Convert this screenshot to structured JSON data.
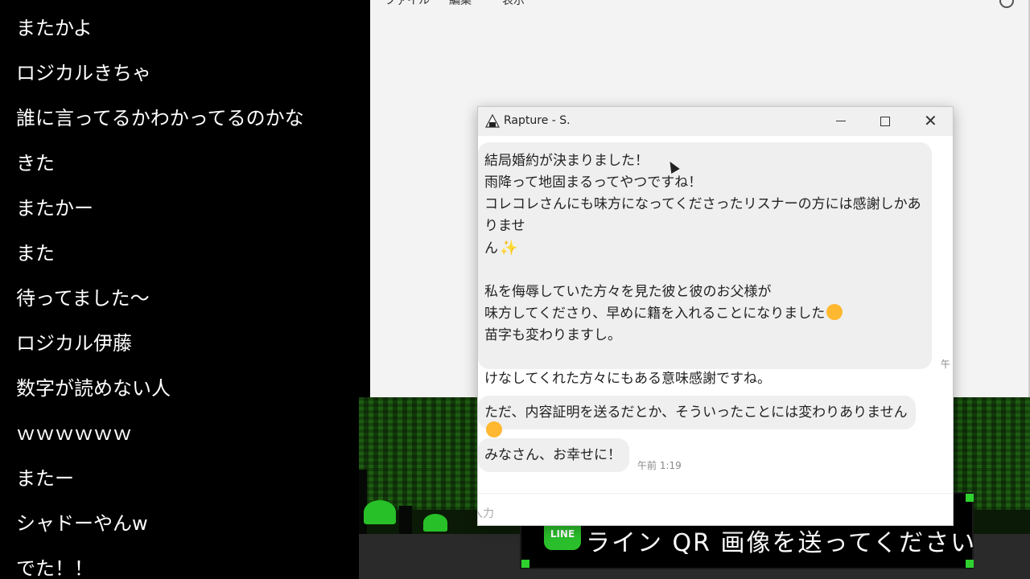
{
  "comments": [
    "またかよ",
    "ロジカルきちゃ",
    "誰に言ってるかわかってるのかな",
    "きた",
    "またかー",
    "また",
    "待ってました〜",
    "ロジカル伊藤",
    "数字が読めない人",
    "ｗｗｗｗｗｗ",
    "またー",
    "シャドーやんw",
    "でた！！"
  ],
  "bg_window": {
    "menu": [
      "ファイル",
      "編集",
      "表示"
    ]
  },
  "chat_window": {
    "title": "Rapture - S.",
    "app_icon": "rice-ball-icon",
    "messages": [
      {
        "lines": [
          "結局婚約が決まりました！",
          "雨降って地固まるってやつですね！",
          "コレコレさんにも味方になってくださったリスナーの方には感謝しかありませ",
          "ん",
          "",
          "私を侮辱していた方々を見た彼と彼のお父様が",
          "味方してくださり、早めに籍を入れることになりました",
          "苗字も変わりますし。",
          "",
          "けなしてくれた方々にもある意味感謝ですね。"
        ],
        "timestamp": "午"
      },
      {
        "text": "ただ、内容証明を送るだとか、そういったことには変わりありません"
      },
      {
        "text": "みなさん、お幸せに！",
        "timestamp": "午前 1:19"
      }
    ],
    "input_placeholder": "入力"
  },
  "game_banner": {
    "logo": "LINE",
    "text": "ライン QR 画像を送ってください"
  },
  "colors": {
    "bubble": "#efefef",
    "grass": "#28c028",
    "comment_text": "#ffffff"
  }
}
